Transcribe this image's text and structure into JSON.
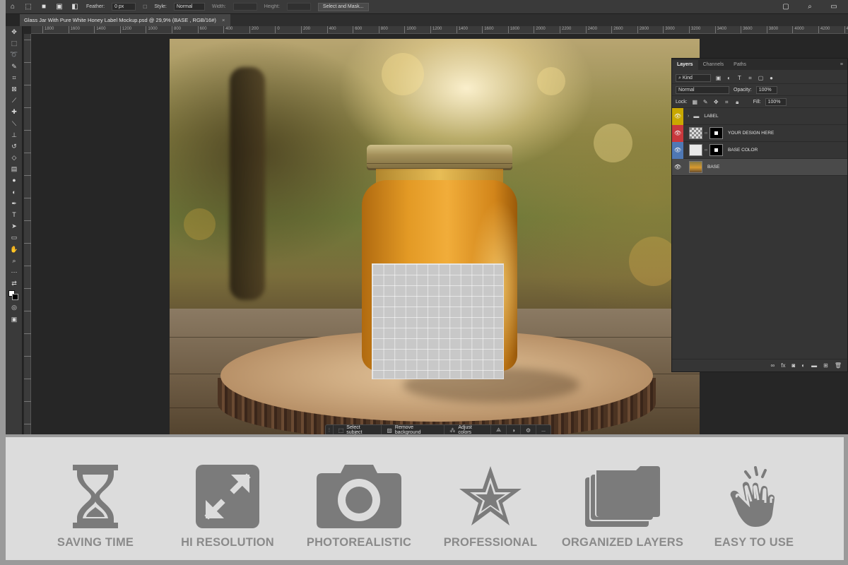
{
  "options_bar": {
    "feather_label": "Feather:",
    "feather_value": "0 px",
    "style_label": "Style:",
    "style_value": "Normal",
    "width_label": "Width:",
    "height_label": "Height:",
    "select_mask_button": "Select and Mask..."
  },
  "document_tab": {
    "title": "Glass Jar With Pure White Honey Label Mockup.psd @ 29,9% (BASE , RGB/16#)",
    "close": "×"
  },
  "ruler": {
    "ticks": [
      "1800",
      "1600",
      "1400",
      "1200",
      "1000",
      "800",
      "600",
      "400",
      "200",
      "0",
      "200",
      "400",
      "600",
      "800",
      "1000",
      "1200",
      "1400",
      "1600",
      "1800",
      "2000",
      "2200",
      "2400",
      "2600",
      "2800",
      "3000",
      "3200",
      "3400",
      "3600",
      "3800",
      "4000",
      "4200",
      "4400"
    ]
  },
  "context_taskbar": {
    "select_subject": "Select subject",
    "remove_background": "Remove background",
    "adjust_colors": "Adjust colors",
    "more": "..."
  },
  "layers_panel": {
    "tabs": [
      "Layers",
      "Channels",
      "Paths"
    ],
    "filter_kind": "Kind",
    "blend_mode": "Normal",
    "opacity_label": "Opacity:",
    "opacity_value": "100%",
    "lock_label": "Lock:",
    "fill_label": "Fill:",
    "fill_value": "100%",
    "layers": [
      {
        "name": "LABEL",
        "type": "group",
        "color": "#c9a800"
      },
      {
        "name": "YOUR DESIGN HERE",
        "type": "smart",
        "color": "#c8383c"
      },
      {
        "name": "BASE COLOR",
        "type": "fill",
        "color": "#4f78b4"
      },
      {
        "name": "BASE",
        "type": "image",
        "color": "#353535",
        "selected": true
      }
    ]
  },
  "features": [
    {
      "label": "SAVING TIME",
      "icon": "hourglass-icon"
    },
    {
      "label": "HI RESOLUTION",
      "icon": "expand-arrows-icon"
    },
    {
      "label": "PHOTOREALISTIC",
      "icon": "camera-icon"
    },
    {
      "label": "PROFESSIONAL",
      "icon": "star-icon"
    },
    {
      "label": "ORGANIZED LAYERS",
      "icon": "stacked-layers-icon"
    },
    {
      "label": "EASY TO USE",
      "icon": "tap-hand-icon"
    }
  ],
  "colors": {
    "feature_icon": "#7b7b7b",
    "feature_bg": "#dcdcdc"
  }
}
